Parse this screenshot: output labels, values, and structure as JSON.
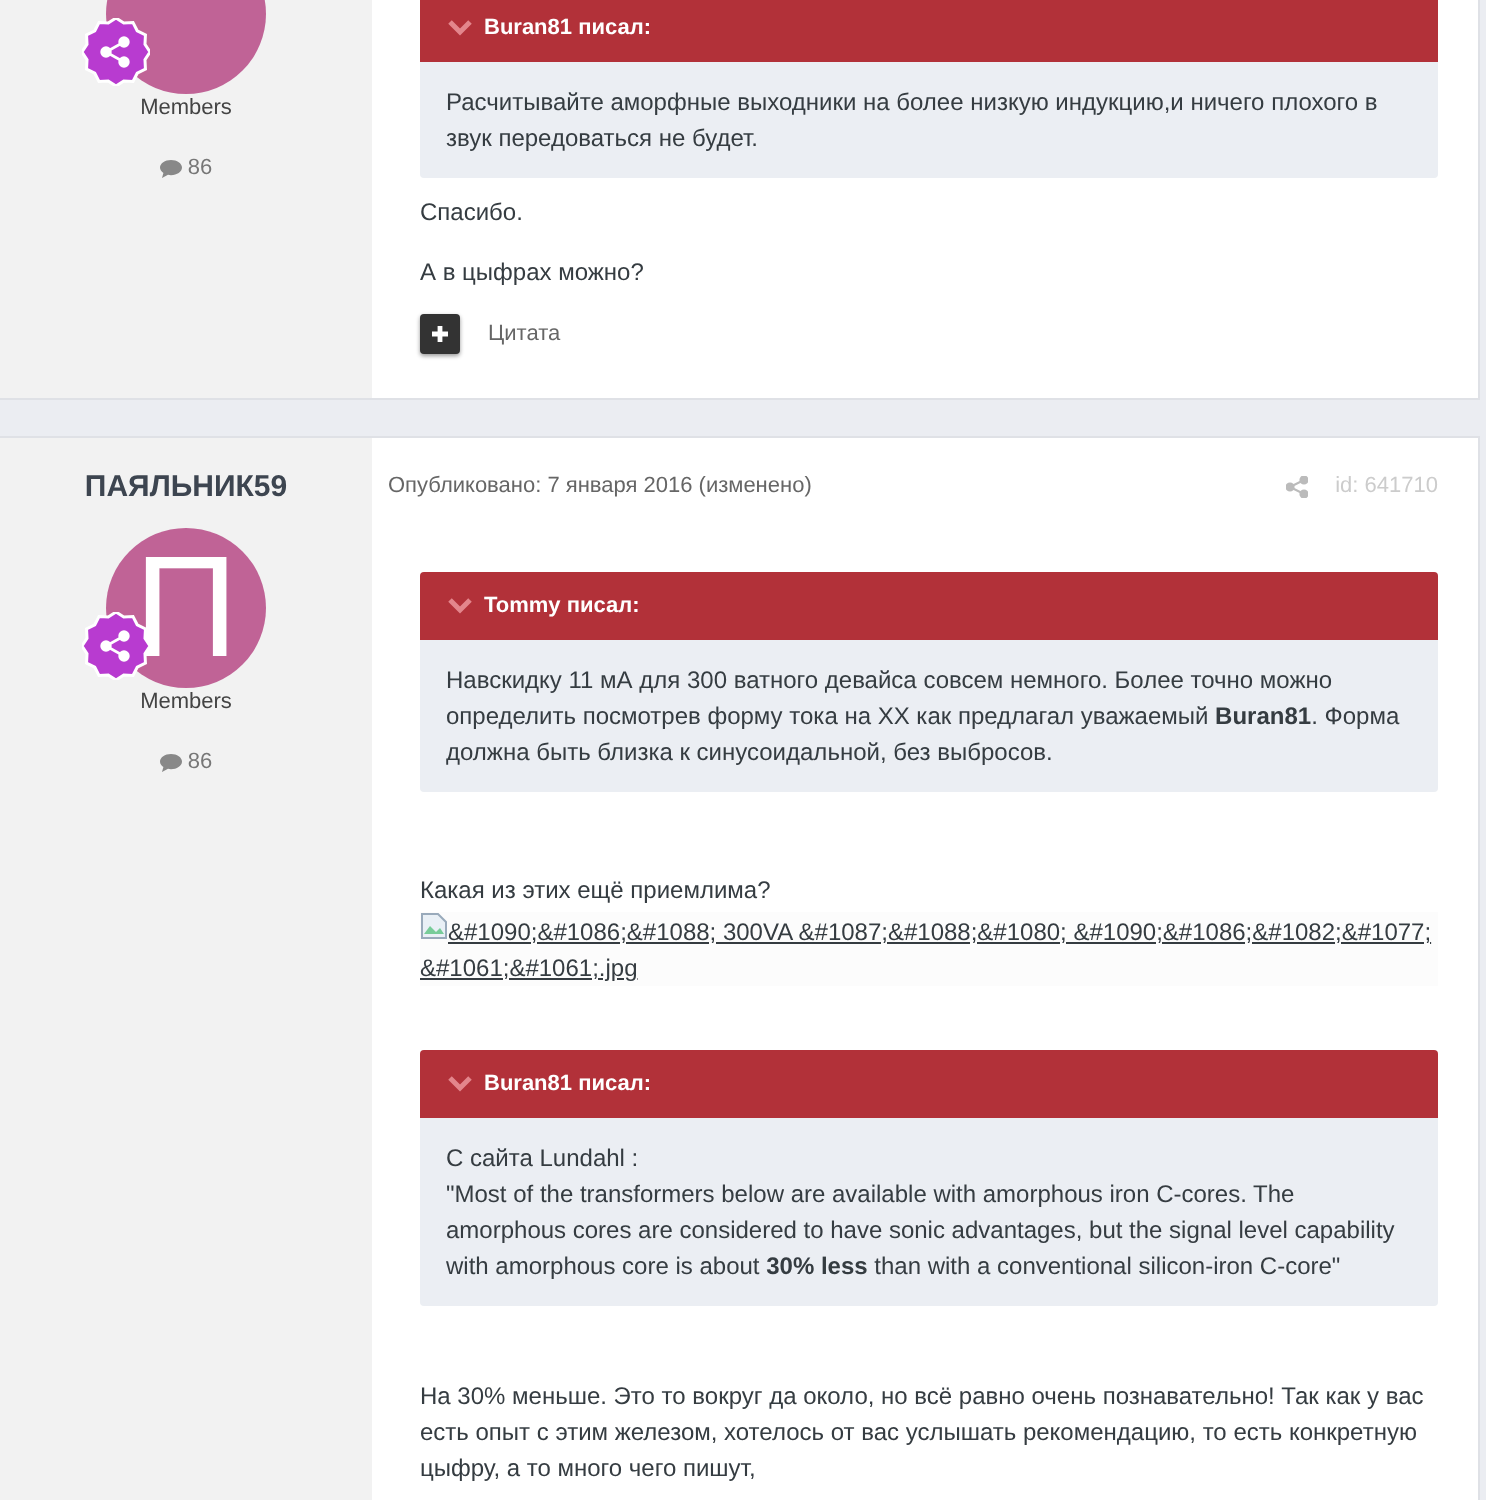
{
  "posts": [
    {
      "group": "Members",
      "post_count": "86",
      "blocks": [
        {
          "kind": "quote",
          "header": "Buran81 писал:",
          "paragraphs": [
            "Расчитывайте аморфные выходники на более низкую индукцию,и ничего плохого в звук передоваться не будет."
          ]
        },
        {
          "kind": "text",
          "text": "Спасибо."
        },
        {
          "kind": "text",
          "text": "А в цыфрах можно?"
        }
      ],
      "actions": [
        {
          "kind": "multiquote",
          "label": "Цитата"
        }
      ]
    },
    {
      "author": "ПАЯЛЬНИК59",
      "avatar_letter": "П",
      "group": "Members",
      "post_count": "86",
      "posted": "Опубликовано: 7 января 2016 (изменено)",
      "post_id": "id: 641710",
      "blocks": [
        {
          "kind": "quote",
          "header": "Tommy писал:",
          "paragraphs": [
            "Навскидку 11 мА для 300 ватного девайса совсем немного. Более точно можно определить посмотрев форму тока на XX как предлагал уважаемый **Buran81**. Форма должна быть близка к синусоидальной, без выбросов."
          ]
        },
        {
          "kind": "text",
          "text": "Какая из этих ещё приемлима?"
        },
        {
          "kind": "image_link",
          "text": "&#1090;&#1086;&#1088; 300VA &#1087;&#1088;&#1080; &#1090;&#1086;&#1082;&#1077; &#1061;&#1061;.jpg"
        },
        {
          "kind": "quote",
          "header": "Buran81 писал:",
          "paragraphs": [
            "С сайта Lundahl :",
            "\"Most of the transformers below are available with amorphous iron C-cores. The amorphous cores are considered to have sonic advantages, but the signal level capability with amorphous core is about **30% less** than with a conventional silicon-iron C-core\""
          ]
        },
        {
          "kind": "text",
          "text": "На 30% меньше. Это то вокруг да около, но всё равно очень познавательно! Так как у вас есть опыт с этим железом, хотелось от вас услышать рекомендацию, то есть конкретную цыфру, а то много чего пишут,"
        }
      ]
    }
  ]
}
